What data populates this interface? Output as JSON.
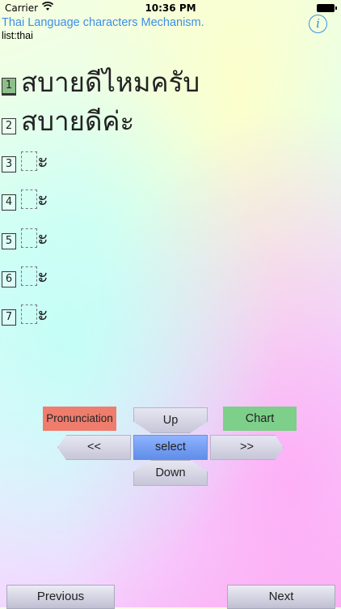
{
  "status_bar": {
    "carrier": "Carrier",
    "time": "10:36 PM"
  },
  "header": {
    "title": "Thai Language characters Mechanism.",
    "list_label": "list:thai",
    "info_label": "i"
  },
  "rows": [
    {
      "number": "1",
      "text": "สบายดีไหมครับ",
      "selected": true
    },
    {
      "number": "2",
      "text": "สบายดีค่ะ"
    },
    {
      "number": "3",
      "text": "ะ"
    },
    {
      "number": "4",
      "text": "ะ"
    },
    {
      "number": "5",
      "text": "ะ"
    },
    {
      "number": "6",
      "text": "ะ"
    },
    {
      "number": "7",
      "text": "ะ"
    }
  ],
  "controls": {
    "pronunciation": "Pronunciation",
    "chart": "Chart",
    "up": "Up",
    "down": "Down",
    "left": "<<",
    "right": ">>",
    "select": "select"
  },
  "footer": {
    "previous": "Previous",
    "next": "Next"
  },
  "colors": {
    "accent": "#3d8ee6",
    "pronunciation": "#ee7d6e",
    "chart": "#7dcf89",
    "select": "#6f97ee"
  }
}
